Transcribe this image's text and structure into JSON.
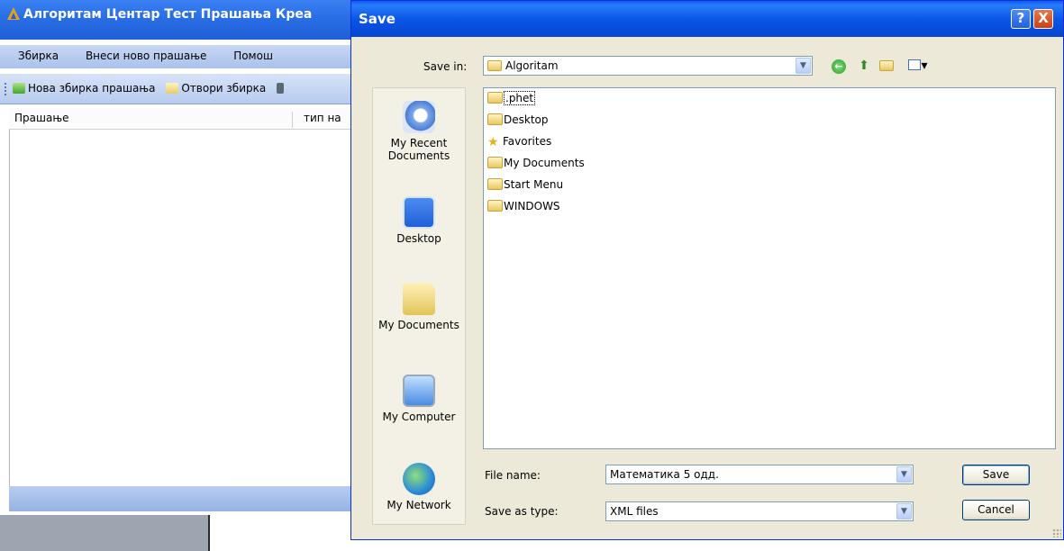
{
  "background_app": {
    "title": "Алгоритам Центар Тест Прашања Креа",
    "menu": [
      "Збирка",
      "Внеси ново прашање",
      "Помош"
    ],
    "toolbar": {
      "new_collection": "Нова збирка прашања",
      "open_collection": "Отвори збирка"
    },
    "columns": {
      "question": "Прашање",
      "type": "тип на"
    }
  },
  "dialog": {
    "title": "Save",
    "help_glyph": "?",
    "close_glyph": "X",
    "save_in_label": "Save in:",
    "save_in_value": "Algoritam",
    "places": [
      {
        "label_line1": "My Recent",
        "label_line2": "Documents",
        "icon": "recent-documents-icon"
      },
      {
        "label_line1": "Desktop",
        "label_line2": "",
        "icon": "desktop-icon"
      },
      {
        "label_line1": "My Documents",
        "label_line2": "",
        "icon": "my-documents-icon"
      },
      {
        "label_line1": "My Computer",
        "label_line2": "",
        "icon": "my-computer-icon"
      },
      {
        "label_line1": "My Network",
        "label_line2": "",
        "icon": "my-network-icon"
      }
    ],
    "files": [
      {
        "name": ".phet",
        "icon": "folder-icon"
      },
      {
        "name": "Desktop",
        "icon": "folder-icon"
      },
      {
        "name": "Favorites",
        "icon": "star-icon"
      },
      {
        "name": "My Documents",
        "icon": "folder-icon"
      },
      {
        "name": "Start Menu",
        "icon": "folder-icon"
      },
      {
        "name": "WINDOWS",
        "icon": "folder-icon"
      }
    ],
    "file_name_label": "File name:",
    "file_name_value": "Математика 5 одд.",
    "save_as_type_label": "Save as type:",
    "save_as_type_value": "XML files",
    "save_button": "Save",
    "cancel_button": "Cancel"
  }
}
